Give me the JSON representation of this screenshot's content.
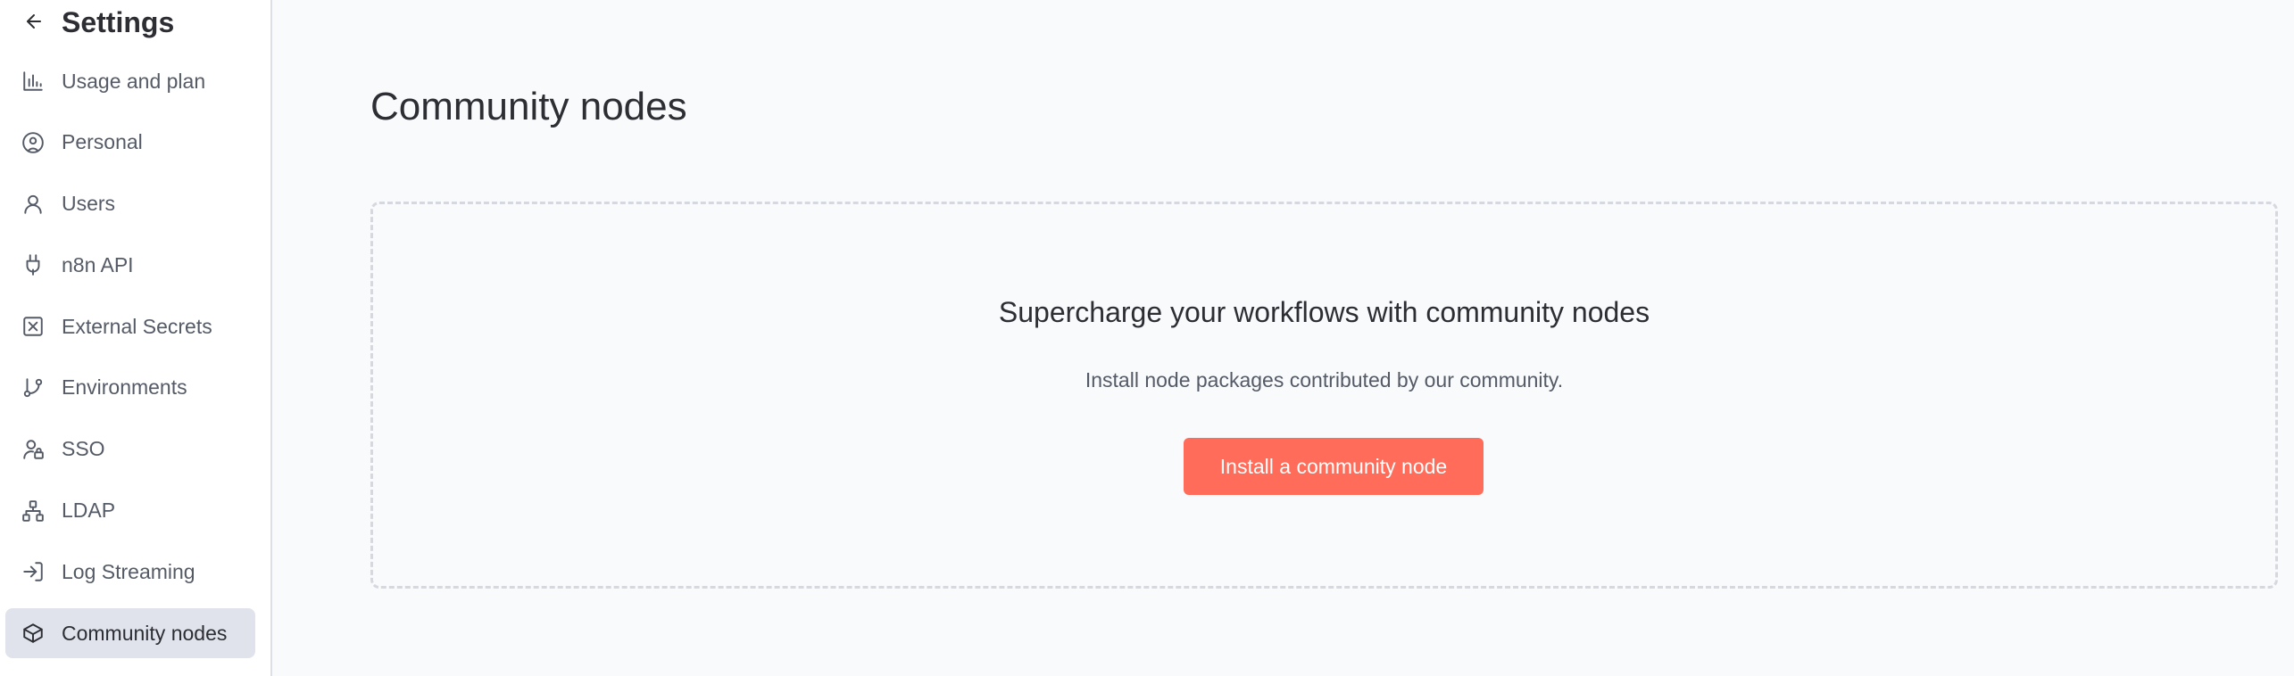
{
  "sidebar": {
    "title": "Settings",
    "back_icon": "arrow-left-icon",
    "items": [
      {
        "label": "Usage and plan",
        "icon": "bar-chart-icon"
      },
      {
        "label": "Personal",
        "icon": "user-circle-icon"
      },
      {
        "label": "Users",
        "icon": "user-icon"
      },
      {
        "label": "n8n API",
        "icon": "plug-icon"
      },
      {
        "label": "External Secrets",
        "icon": "square-x-icon"
      },
      {
        "label": "Environments",
        "icon": "git-branch-icon"
      },
      {
        "label": "SSO",
        "icon": "user-lock-icon"
      },
      {
        "label": "LDAP",
        "icon": "network-icon"
      },
      {
        "label": "Log Streaming",
        "icon": "log-in-icon"
      },
      {
        "label": "Community nodes",
        "icon": "box-icon",
        "active": true
      }
    ]
  },
  "main": {
    "title": "Community nodes",
    "empty_state": {
      "heading": "Supercharge your workflows with community nodes",
      "description": "Install node packages contributed by our community.",
      "button_label": "Install a community node"
    }
  },
  "colors": {
    "accent": "#ff6d5a",
    "active_nav_bg": "#e0e3ec",
    "page_bg": "#f9fafc",
    "sidebar_bg": "#ffffff"
  }
}
